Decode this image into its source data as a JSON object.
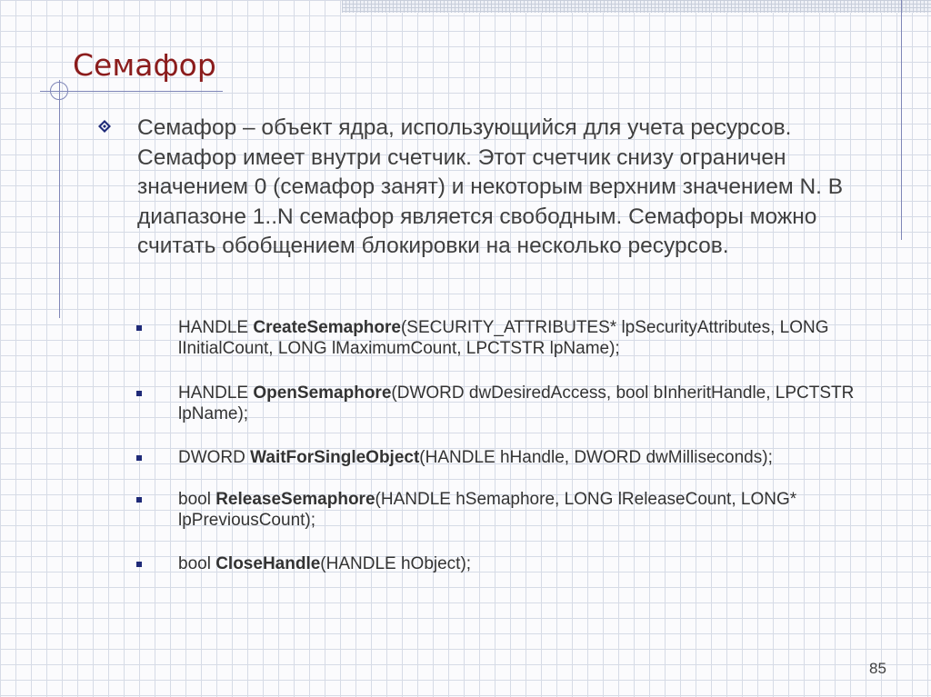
{
  "slide": {
    "title": "Семафор",
    "main_text": "Семафор – объект ядра, использующийся для учета ресурсов. Семафор имеет внутри счетчик. Этот счетчик снизу ограничен значением 0 (семафор занят) и некоторым верхним значением N. В диапазоне 1..N семафор является свободным. Семафоры можно считать обобщением блокировки на несколько ресурсов.",
    "functions": [
      {
        "prefix": "HANDLE ",
        "name": "CreateSemaphore",
        "suffix": "(SECURITY_ATTRIBUTES* lpSecurityAttributes, LONG lInitialCount, LONG lMaximumCount, LPCTSTR lpName);"
      },
      {
        "prefix": "HANDLE ",
        "name": "OpenSemaphore",
        "suffix": "(DWORD dwDesiredAccess, bool bInheritHandle, LPCTSTR lpName);"
      },
      {
        "prefix": "DWORD ",
        "name": "WaitForSingleObject",
        "suffix": "(HANDLE hHandle, DWORD dwMilliseconds);"
      },
      {
        "prefix": "bool ",
        "name": "ReleaseSemaphore",
        "suffix": "(HANDLE hSemaphore, LONG lReleaseCount, LONG* lpPreviousCount);"
      },
      {
        "prefix": "bool ",
        "name": "CloseHandle",
        "suffix": "(HANDLE hObject);"
      }
    ],
    "page_number": "85"
  },
  "colors": {
    "title": "#8b1c1c",
    "body_text": "#404040",
    "bullet": "#1f2a78",
    "lines": "#7f86b8"
  },
  "icons": {
    "main_bullet": "diamond-bullet-icon",
    "sub_bullet": "square-bullet-icon"
  }
}
